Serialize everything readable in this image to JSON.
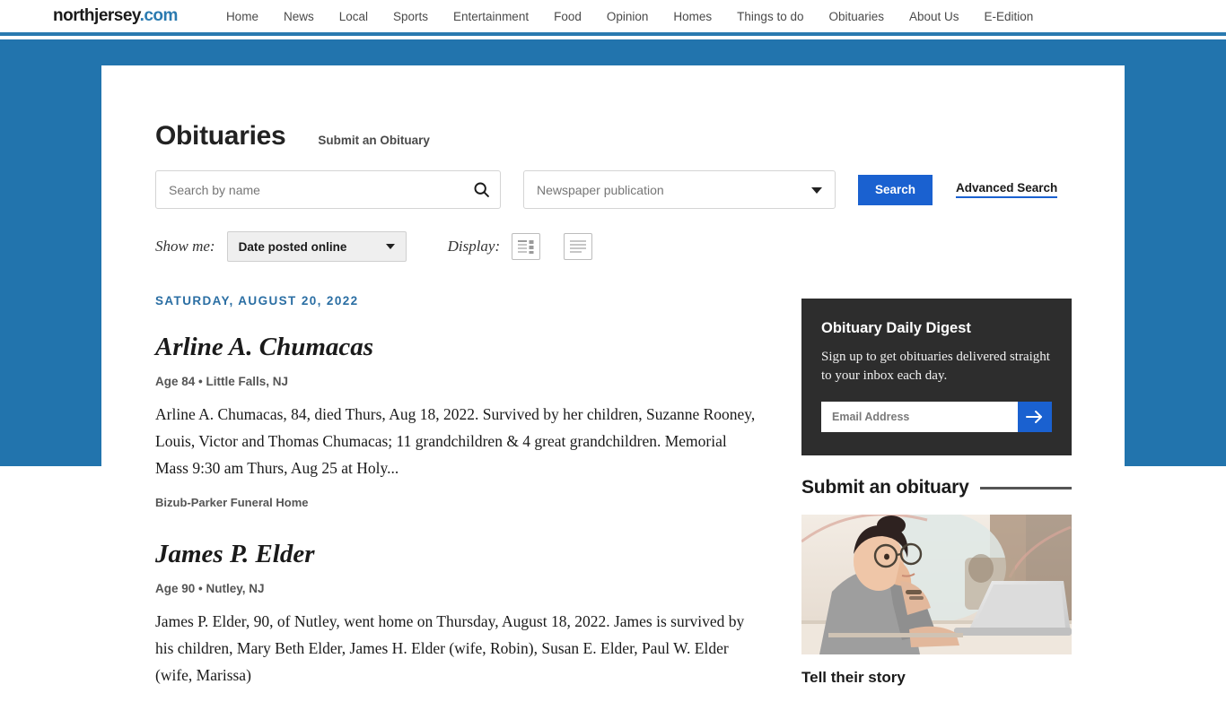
{
  "site": {
    "logo_main": "northjersey",
    "logo_dot": ".com",
    "nav": [
      {
        "label": "Home"
      },
      {
        "label": "News"
      },
      {
        "label": "Local"
      },
      {
        "label": "Sports"
      },
      {
        "label": "Entertainment"
      },
      {
        "label": "Food"
      },
      {
        "label": "Opinion"
      },
      {
        "label": "Homes"
      },
      {
        "label": "Things to do"
      },
      {
        "label": "Obituaries"
      },
      {
        "label": "About Us"
      },
      {
        "label": "E-Edition"
      }
    ]
  },
  "page": {
    "title": "Obituaries",
    "submit_obituary_link": "Submit an Obituary"
  },
  "search": {
    "name_placeholder": "Search by name",
    "name_value": "",
    "publication_placeholder": "Newspaper publication",
    "publication_selected": "Newspaper publication",
    "publication_options": [
      "Newspaper publication"
    ],
    "search_button": "Search",
    "advanced_search": "Advanced Search"
  },
  "filters": {
    "show_me_label": "Show me:",
    "show_me_selected": "Date posted online",
    "show_me_options": [
      "Date posted online"
    ],
    "display_label": "Display:",
    "display_grid_name": "grid-view-icon",
    "display_list_name": "list-view-icon"
  },
  "results": {
    "date_header": "SATURDAY, AUGUST 20, 2022",
    "obituaries": [
      {
        "name": "Arline A. Chumacas",
        "age": "Age 84",
        "separator": "•",
        "location": "Little Falls, NJ",
        "meta": "Age 84 • Little Falls, NJ",
        "body": "Arline A. Chumacas, 84, died Thurs, Aug 18, 2022. Survived by her children, Suzanne Rooney, Louis, Victor and Thomas Chumacas; 11 grandchildren & 4 great grandchildren. Memorial Mass 9:30 am Thurs, Aug 25 at Holy...",
        "funeral_home": "Bizub-Parker Funeral Home"
      },
      {
        "name": "James P. Elder",
        "age": "Age 90",
        "separator": "•",
        "location": "Nutley, NJ",
        "meta": "Age 90 • Nutley, NJ",
        "body": "James P. Elder, 90, of Nutley, went home on Thursday, August 18, 2022. James is survived by his children, Mary Beth Elder, James H. Elder (wife, Robin), Susan E. Elder, Paul W. Elder (wife, Marissa)",
        "funeral_home": ""
      }
    ]
  },
  "sidebar": {
    "digest": {
      "title": "Obituary Daily Digest",
      "description": "Sign up to get obituaries delivered straight to your inbox each day.",
      "email_placeholder": "Email Address",
      "email_value": "",
      "submit_icon": "arrow-right-icon"
    },
    "submit_section": {
      "title": "Submit an obituary",
      "image_alt": "woman-at-laptop-photo",
      "caption": "Tell their story"
    }
  },
  "colors": {
    "band_blue": "#2274ad",
    "accent_blue": "#1a61d0",
    "date_blue": "#2a6ea3",
    "dark_panel": "#2d2d2d"
  }
}
